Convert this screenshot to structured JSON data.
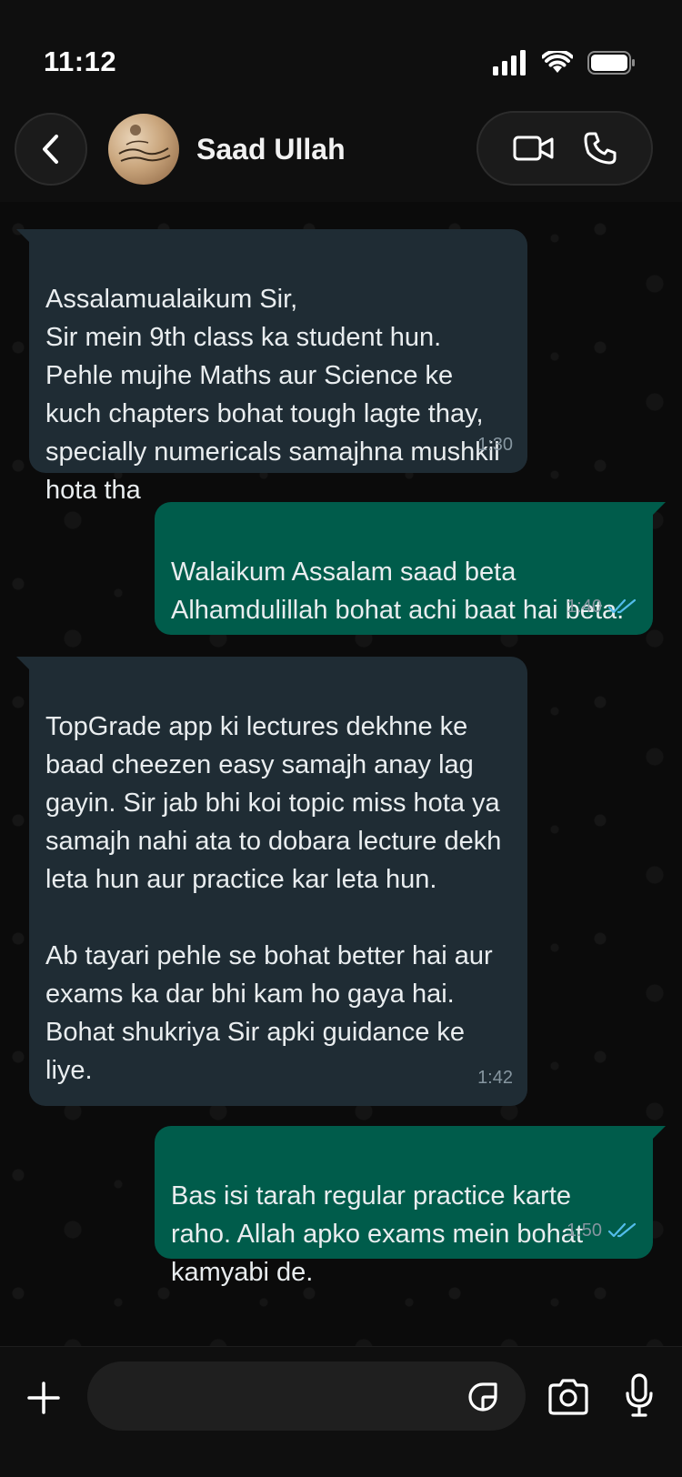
{
  "status_bar": {
    "time": "11:12",
    "icons": [
      "signal-icon",
      "wifi-icon",
      "battery-icon"
    ]
  },
  "header": {
    "contact_name": "Saad Ullah",
    "back_icon": "chevron-left-icon",
    "video_icon": "video-camera-icon",
    "call_icon": "phone-icon"
  },
  "messages": [
    {
      "direction": "incoming",
      "text": "Assalamualaikum Sir,\nSir mein 9th class ka student hun. Pehle mujhe Maths aur Science ke kuch chapters bohat tough lagte thay, specially numericals samajhna mushkil hota tha",
      "time": "1:30"
    },
    {
      "direction": "outgoing",
      "text": "Walaikum Assalam saad beta Alhamdulillah bohat achi baat hai beta.",
      "time": "1:40",
      "read": true
    },
    {
      "direction": "incoming",
      "text": "TopGrade app ki lectures dekhne ke baad cheezen easy samajh anay lag gayin. Sir jab bhi koi topic miss hota ya samajh nahi ata to dobara lecture dekh leta hun aur practice kar leta hun.\n\nAb tayari pehle se bohat better hai aur exams ka dar bhi kam ho gaya hai. Bohat shukriya Sir apki guidance ke liye.",
      "time": "1:42"
    },
    {
      "direction": "outgoing",
      "text": "Bas isi tarah regular practice karte raho. Allah apko exams mein bohat kamyabi de.",
      "time": "1.50",
      "read": true
    }
  ],
  "composer": {
    "value": "",
    "icons": [
      "plus-icon",
      "sticker-icon",
      "camera-icon",
      "microphone-icon"
    ]
  },
  "colors": {
    "incoming_bubble": "#1f2c34",
    "outgoing_bubble": "#005c4b",
    "read_tick": "#53bdeb",
    "background": "#0b0b0b"
  }
}
